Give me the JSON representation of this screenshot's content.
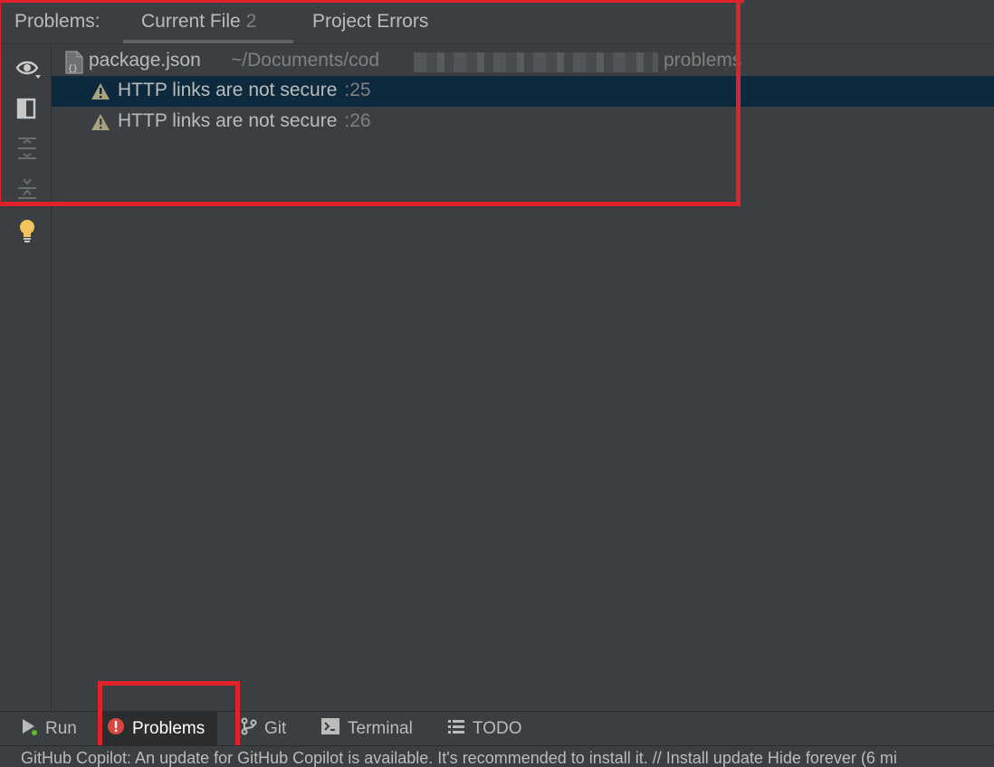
{
  "header": {
    "title": "Problems:",
    "tabs": [
      {
        "label": "Current File",
        "count": "2"
      },
      {
        "label": "Project Errors"
      }
    ]
  },
  "side_toolbar": {
    "icons": [
      "eye-icon",
      "preview-panel-icon",
      "expand-all-icon",
      "collapse-all-icon",
      "lightbulb-icon"
    ]
  },
  "tree": {
    "file": {
      "name": "package.json",
      "path_prefix": "~/Documents/cod",
      "path_suffix": "problems"
    },
    "problems": [
      {
        "message": "HTTP links are not secure",
        "line": ":25",
        "selected": true
      },
      {
        "message": "HTTP links are not secure",
        "line": ":26",
        "selected": false
      }
    ]
  },
  "bottom_bar": {
    "items": [
      {
        "label": "Run",
        "icon": "run-icon"
      },
      {
        "label": "Problems",
        "icon": "error-icon",
        "active": true
      },
      {
        "label": "Git",
        "icon": "git-branch-icon"
      },
      {
        "label": "Terminal",
        "icon": "terminal-icon"
      },
      {
        "label": "TODO",
        "icon": "list-icon"
      }
    ]
  },
  "status": {
    "text": "GitHub Copilot: An update for GitHub Copilot is available. It's recommended to install it. // Install update   Hide forever (6 mi"
  },
  "colors": {
    "background": "#3c3f41",
    "selection": "#0d293e",
    "annotation_red": "#e0232a",
    "warning": "#a8a27e",
    "error": "#d9473f"
  }
}
